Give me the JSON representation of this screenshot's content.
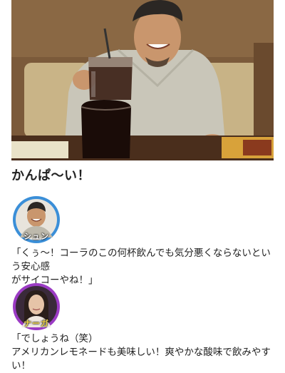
{
  "article": {
    "heading": "かんぱ〜い！"
  },
  "comments": [
    {
      "speaker": "シュン",
      "ring_color": "#3b8fd8",
      "lines": [
        "「くぅ〜！コーラのこの何杯飲んでも気分悪くならないという安心感",
        "がサイコーやね！」"
      ]
    },
    {
      "speaker": "ナーガ",
      "ring_color": "#9b3bc4",
      "lines": [
        "「でしょうね（笑）",
        "アメリカンレモネードも美味しい！爽やかな酸味で飲みやすい！"
      ]
    }
  ]
}
